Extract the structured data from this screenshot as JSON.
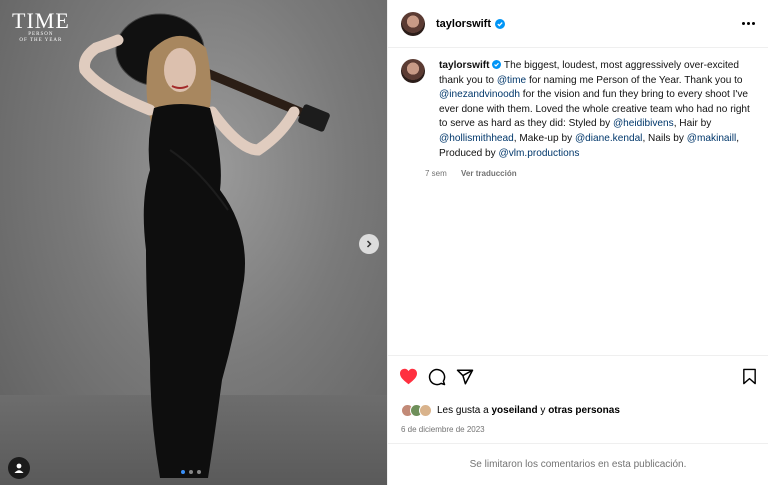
{
  "photo": {
    "time_title": "TIME",
    "time_subtitle_1": "PERSON",
    "time_subtitle_2": "OF THE YEAR",
    "next_icon": "chevron-right-icon",
    "user_tag_icon": "person-icon",
    "carousel": {
      "count": 3,
      "active": 1
    }
  },
  "header": {
    "username": "taylorswift",
    "verified_icon": "verified-badge-icon",
    "more_icon": "more-options-icon"
  },
  "caption": {
    "username": "taylorswift",
    "parts": [
      " The biggest, loudest, most aggressively over-excited thank you to ",
      "@time",
      " for naming me Person of the Year. Thank you to ",
      "@inezandvinoodh",
      " for the vision and fun they bring to every shoot I've ever done with them. Loved the whole creative team who had no right to serve as hard as they did: Styled by ",
      "@heidibivens",
      ", Hair by ",
      "@hollismithhead",
      ", Make-up by ",
      "@diane.kendal",
      ", Nails by ",
      "@makinaill",
      ", Produced by ",
      "@vlm.productions"
    ],
    "time_ago": "7 sem",
    "translate": "Ver traducción"
  },
  "actions": {
    "like_icon": "heart-filled-icon",
    "comment_icon": "comment-icon",
    "share_icon": "share-icon",
    "save_icon": "bookmark-icon",
    "like_color": "#ff3040"
  },
  "likes": {
    "prefix": "Les gusta a ",
    "user": "yoseiland",
    "connector": " y ",
    "others": "otras personas"
  },
  "date": "6 de diciembre de 2023",
  "comments_disabled": "Se limitaron los comentarios en esta publicación."
}
